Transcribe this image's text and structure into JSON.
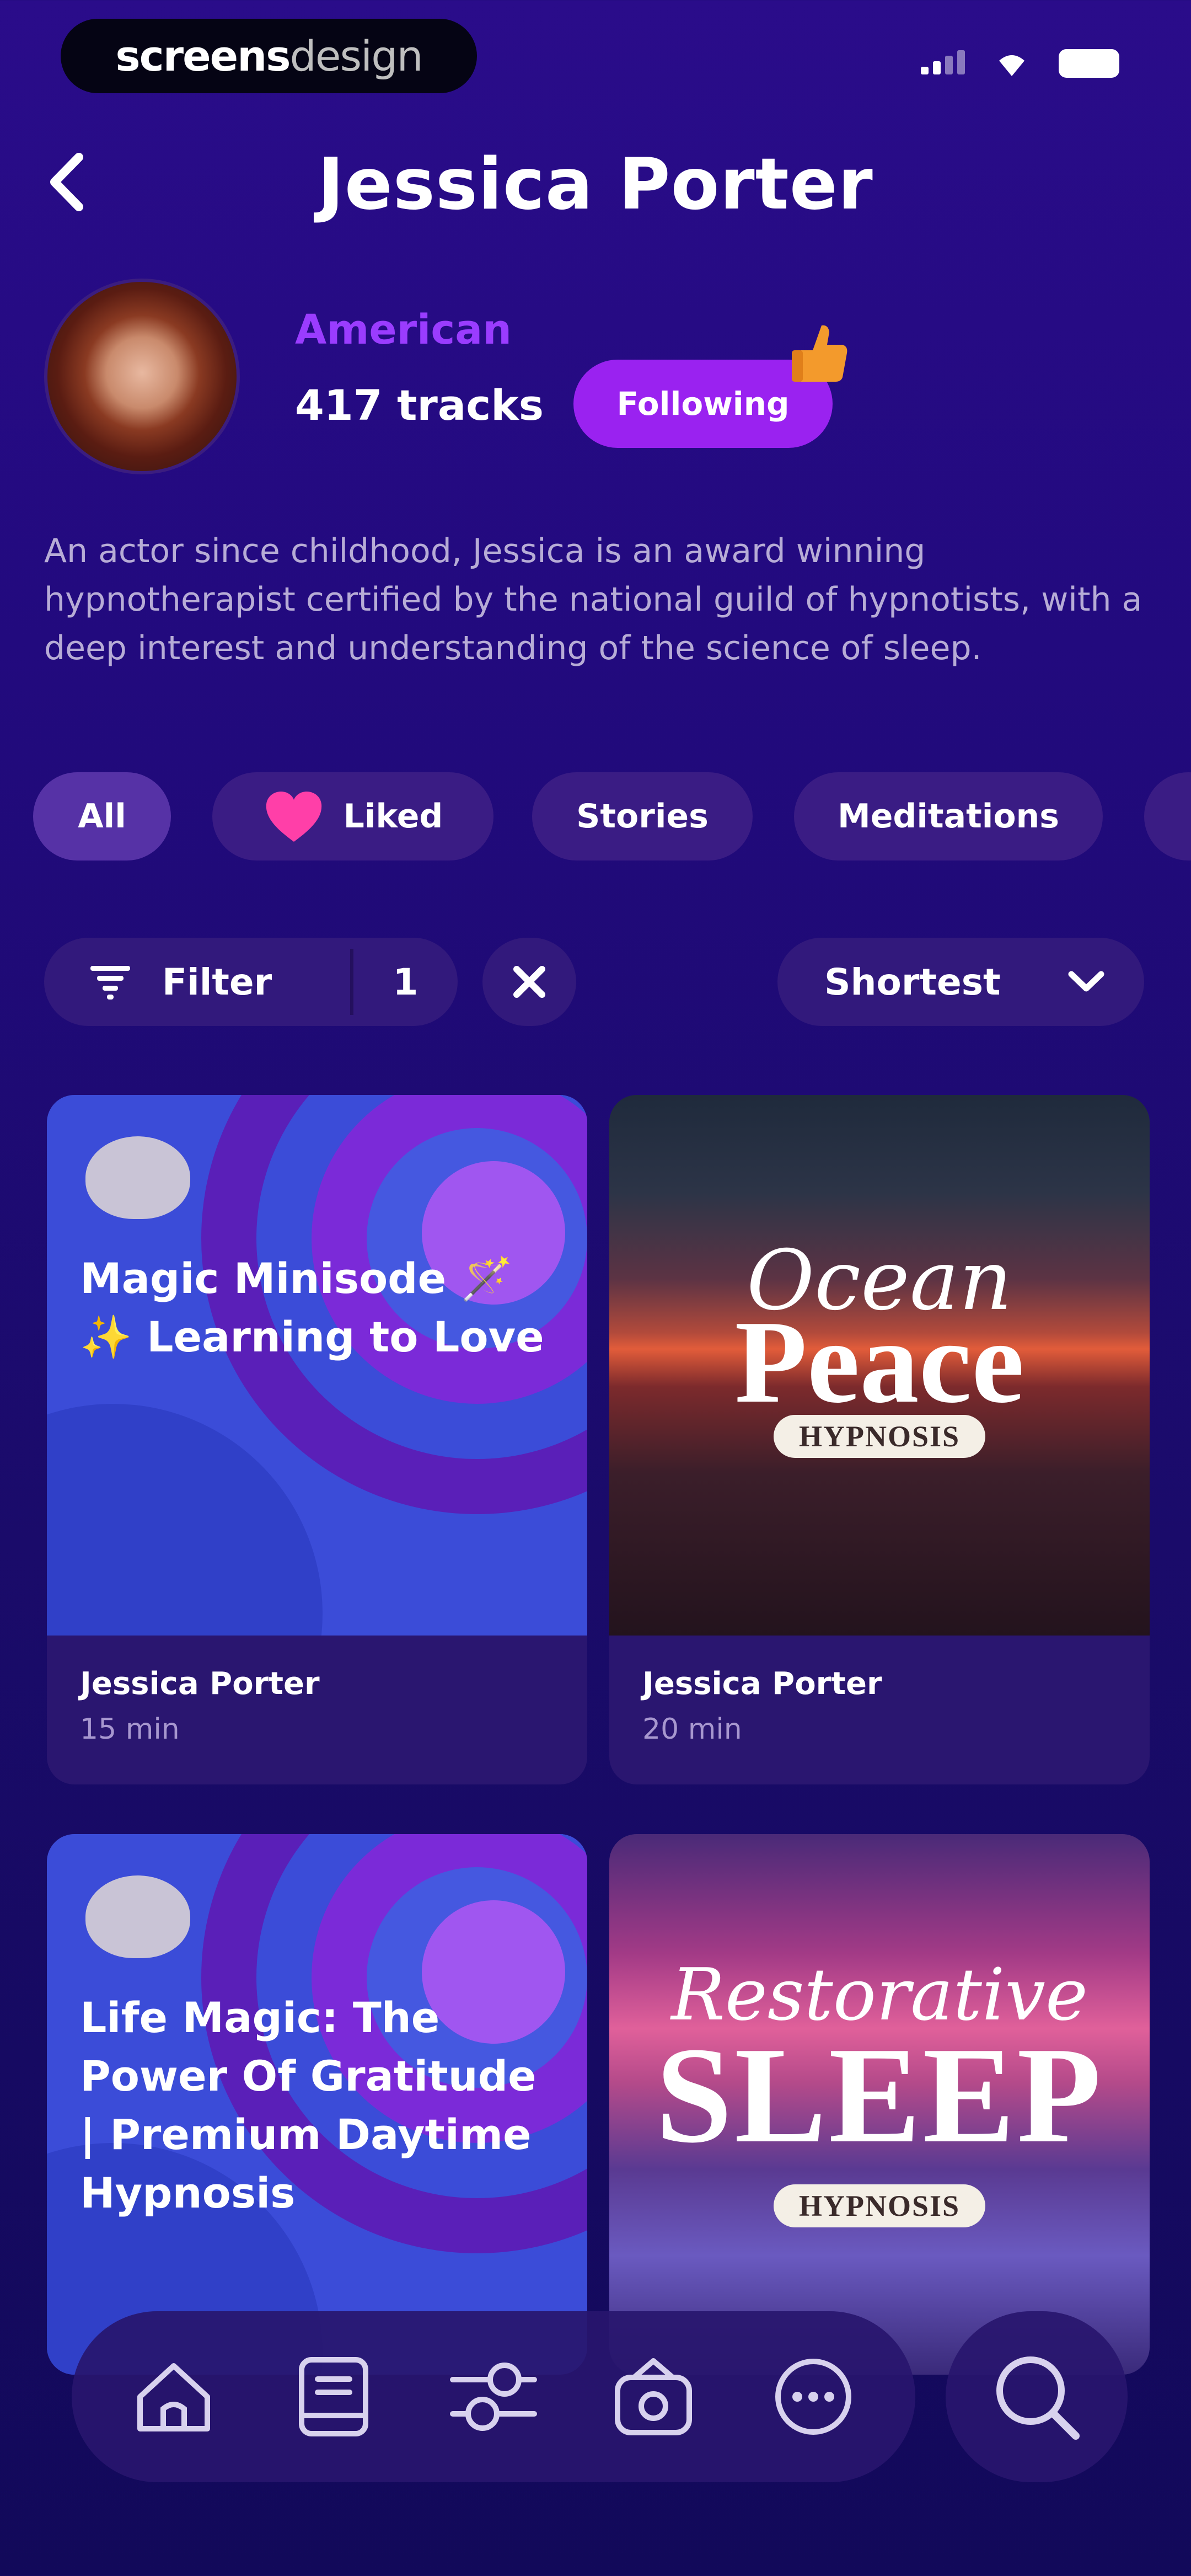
{
  "status_bar": {
    "brand_bold": "screens",
    "brand_thin": "design"
  },
  "header": {
    "title": "Jessica Porter"
  },
  "profile": {
    "nationality": "American",
    "tracks": "417 tracks",
    "follow_label": "Following",
    "bio": "An actor since childhood, Jessica is an award winning hypnotherapist certified by the national guild of hypnotists, with a deep interest and understanding of the science of sleep."
  },
  "categories": [
    {
      "label": "All",
      "active": true
    },
    {
      "label": "Liked",
      "icon": "heart-icon"
    },
    {
      "label": "Stories"
    },
    {
      "label": "Meditations"
    }
  ],
  "filters": {
    "filter_label": "Filter",
    "filter_count": "1",
    "sort_value": "Shortest"
  },
  "tracks": [
    {
      "title": "Magic Minisode 🪄 ✨ Learning to Love",
      "author": "Jessica Porter",
      "duration": "15 min"
    },
    {
      "poster_script": "Ocean",
      "poster_big": "Peace",
      "poster_badge": "HYPNOSIS",
      "author": "Jessica Porter",
      "duration": "20 min"
    },
    {
      "title": "Life Magic: The Power Of Gratitude | Premium Daytime Hypnosis"
    },
    {
      "poster_script": "Restorative",
      "poster_big": "SLEEP",
      "poster_badge": "HYPNOSIS"
    }
  ],
  "nav": {
    "items": [
      "home-icon",
      "library-icon",
      "sliders-icon",
      "radio-icon",
      "more-icon"
    ],
    "search": "search-icon"
  },
  "colors": {
    "accent": "#9a22f0",
    "nationality": "#9a3cff",
    "background_top": "#2a0c8a",
    "background_bottom": "#12095a"
  }
}
